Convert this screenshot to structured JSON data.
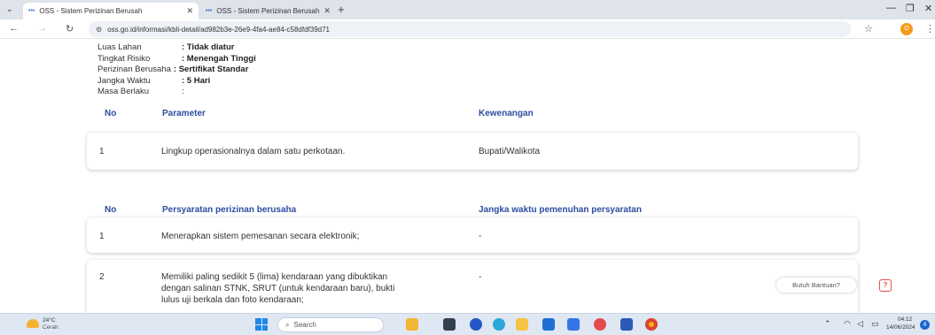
{
  "browser": {
    "tabs": [
      {
        "label": "OSS - Sistem Perizinan Berusah",
        "active": true
      },
      {
        "label": "OSS - Sistem Perizinan Berusah",
        "active": false
      }
    ],
    "new_tab": "+",
    "url": "oss.go.id/informasi/kbli-detail/ad982b3e-26e9-4fa4-ae84-c58dfdf39d71",
    "profile_initial": "O"
  },
  "info": [
    {
      "label": "Luas Lahan",
      "value": ": Tidak diatur"
    },
    {
      "label": "Tingkat Risiko",
      "value": ": Menengah Tinggi"
    },
    {
      "label": "Perizinan Berusaha",
      "value": ": Sertifikat Standar"
    },
    {
      "label": "Jangka Waktu",
      "value": ": 5 Hari"
    },
    {
      "label": "Masa Berlaku",
      "value": ":"
    }
  ],
  "table1": {
    "headers": {
      "no": "No",
      "param": "Parameter",
      "auth": "Kewenangan"
    },
    "rows": [
      {
        "no": "1",
        "param": "Lingkup operasionalnya dalam satu perkotaan.",
        "auth": "Bupati/Walikota"
      }
    ]
  },
  "table2": {
    "headers": {
      "no": "No",
      "req": "Persyaratan perizinan berusaha",
      "time": "Jangka waktu pemenuhan persyaratan"
    },
    "rows": [
      {
        "no": "1",
        "req": "Menerapkan sistem pemesanan secara elektronik;",
        "time": "-"
      },
      {
        "no": "2",
        "req_lines": [
          "Memiliki paling sedikit 5 (lima) kendaraan yang dibuktikan",
          "dengan salinan STNK, SRUT (untuk kendaraan baru), bukti",
          "lulus uji berkala dan foto kendaraan;"
        ],
        "time": "-"
      }
    ]
  },
  "help": {
    "label": "Butuh Bantuan?",
    "icon": "?"
  },
  "taskbar": {
    "weather_temp": "24°C",
    "weather_cond": "Cerah",
    "search_placeholder": "Search",
    "time": "04:12",
    "date": "14/06/2024",
    "notif_count": "4"
  }
}
